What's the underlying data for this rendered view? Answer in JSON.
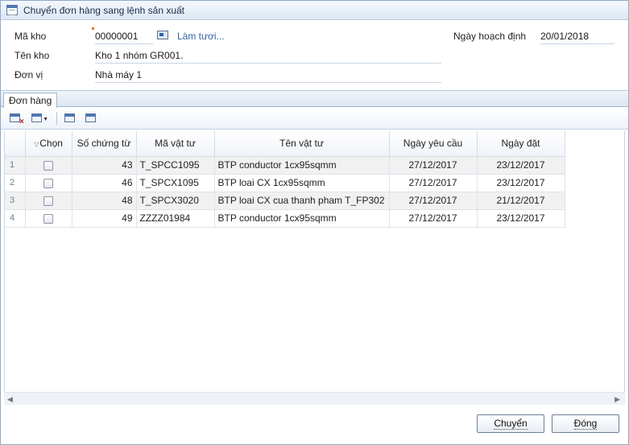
{
  "window": {
    "title": "Chuyển đơn hàng sang lệnh sản xuất"
  },
  "form": {
    "warehouse_code_label": "Mã kho",
    "warehouse_code_value": "00000001",
    "refresh_label": "Làm tươi...",
    "warehouse_name_label": "Tên kho",
    "warehouse_name_value": "Kho 1 nhóm GR001.",
    "unit_label": "Đơn vị",
    "unit_value": "Nhà máy 1",
    "plan_date_label": "Ngày hoạch định",
    "plan_date_value": "20/01/2018"
  },
  "tabs": [
    {
      "label": "Đơn hàng"
    }
  ],
  "toolbar": {
    "icons": [
      "clear-grid-icon",
      "column-chooser-icon",
      "export-icon",
      "grid-settings-icon"
    ]
  },
  "grid": {
    "columns": [
      "Chọn",
      "Số chứng từ",
      "Mã vật tư",
      "Tên vật tư",
      "Ngày yêu cầu",
      "Ngày đặt"
    ],
    "rows": [
      {
        "num": "1",
        "doc_no": "43",
        "material_code": "T_SPCC1095",
        "material_name": "BTP conductor 1cx95sqmm",
        "request_date": "27/12/2017",
        "order_date": "23/12/2017"
      },
      {
        "num": "2",
        "doc_no": "46",
        "material_code": "T_SPCX1095",
        "material_name": "BTP loai CX 1cx95sqmm",
        "request_date": "27/12/2017",
        "order_date": "23/12/2017"
      },
      {
        "num": "3",
        "doc_no": "48",
        "material_code": "T_SPCX3020",
        "material_name": "BTP loai CX cua thanh pham T_FP302",
        "request_date": "27/12/2017",
        "order_date": "21/12/2017"
      },
      {
        "num": "4",
        "doc_no": "49",
        "material_code": "ZZZZ01984",
        "material_name": "BTP conductor 1cx95sqmm",
        "request_date": "27/12/2017",
        "order_date": "23/12/2017"
      }
    ]
  },
  "buttons": {
    "transfer": "Chuyển",
    "close": "Đóng"
  }
}
